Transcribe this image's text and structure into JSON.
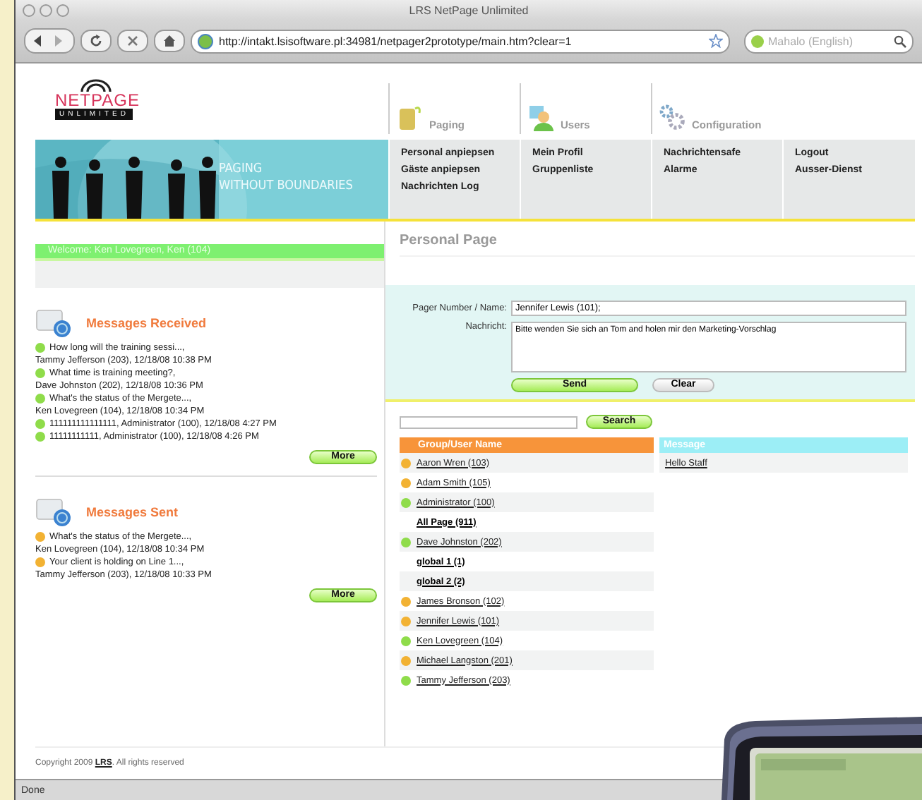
{
  "window": {
    "title": "LRS NetPage Unlimited"
  },
  "toolbar": {
    "url": "http://intakt.lsisoftware.pl:34981/netpager2prototype/main.htm?clear=1",
    "search_placeholder": "Mahalo (English)"
  },
  "logo": {
    "name": "NETPAGE",
    "sub": "UNLIMITED"
  },
  "nav_tabs": [
    {
      "label": "Paging",
      "kind": "paging"
    },
    {
      "label": "Users",
      "kind": "users"
    },
    {
      "label": "Configuration",
      "kind": "config"
    }
  ],
  "banner": {
    "tagline": [
      "PAGING",
      "WITHOUT BOUNDARIES"
    ]
  },
  "menu_columns": [
    [
      "Personal anpiepsen",
      "Gäste anpiepsen",
      "Nachrichten Log"
    ],
    [
      "Mein Profil",
      "Gruppenliste"
    ],
    [
      "Nachrichtensafe",
      "Alarme"
    ],
    [
      "Logout",
      "Ausser-Dienst"
    ]
  ],
  "welcome": "Welcome: Ken Lovegreen, Ken (104)",
  "messages_received": {
    "title": "Messages Received",
    "more": "More",
    "items": [
      {
        "color": "#8fdc4a",
        "text": "How long will the training sessi...,",
        "sender": "Tammy Jefferson (203), 12/18/08 10:38 PM"
      },
      {
        "color": "#8fdc4a",
        "text": "What time is training meeting?,",
        "sender": "Dave Johnston (202), 12/18/08 10:36 PM"
      },
      {
        "color": "#8fdc4a",
        "text": "What's the status of the Mergete...,",
        "sender": "Ken Lovegreen (104), 12/18/08 10:34 PM"
      },
      {
        "color": "#8fdc4a",
        "text": "111111111111111, Administrator (100), 12/18/08 4:27 PM"
      },
      {
        "color": "#8fdc4a",
        "text": "11111111111, Administrator (100), 12/18/08 4:26 PM"
      }
    ]
  },
  "messages_sent": {
    "title": "Messages Sent",
    "more": "More",
    "items": [
      {
        "color": "#f2b233",
        "text": "What's the status of the Mergete...,",
        "sender": "Ken Lovegreen (104), 12/18/08 10:34 PM"
      },
      {
        "color": "#f2b233",
        "text": "Your client is holding on Line 1...,",
        "sender": "Tammy Jefferson (203), 12/18/08 10:33 PM"
      }
    ]
  },
  "personal_page": {
    "title": "Personal Page",
    "pager_label": "Pager Number / Name:",
    "pager_value": "Jennifer Lewis (101);",
    "message_label": "Nachricht:",
    "message_value": "Bitte wenden Sie sich an Tom and holen mir den Marketing-Vorschlag",
    "send": "Send",
    "clear": "Clear"
  },
  "search": {
    "button": "Search"
  },
  "users_table": {
    "columns": [
      "Group/User Name",
      "Message"
    ],
    "rows": [
      {
        "kind": "user",
        "color": "#f2b233",
        "name": "Aaron Wren (103)",
        "message": "Hello Staff"
      },
      {
        "kind": "user",
        "color": "#f2b233",
        "name": "Adam Smith (105)"
      },
      {
        "kind": "user",
        "color": "#8fdc4a",
        "name": "Administrator (100)"
      },
      {
        "kind": "group",
        "name": "All Page (911)"
      },
      {
        "kind": "user",
        "color": "#8fdc4a",
        "name": "Dave Johnston (202)"
      },
      {
        "kind": "group",
        "name": "global 1 (1)"
      },
      {
        "kind": "group",
        "name": "global 2 (2)"
      },
      {
        "kind": "user",
        "color": "#f2b233",
        "name": "James Bronson (102)"
      },
      {
        "kind": "user",
        "color": "#f2b233",
        "name": "Jennifer Lewis (101)"
      },
      {
        "kind": "user",
        "color": "#8fdc4a",
        "name": "Ken Lovegreen (104)"
      },
      {
        "kind": "user",
        "color": "#f2b233",
        "name": "Michael Langston (201)"
      },
      {
        "kind": "user",
        "color": "#8fdc4a",
        "name": "Tammy Jefferson (203)"
      }
    ]
  },
  "footer": {
    "prefix": "Copyright 2009",
    "link": "LRS",
    "suffix": ". All rights reserved"
  },
  "status_bar": "Done"
}
